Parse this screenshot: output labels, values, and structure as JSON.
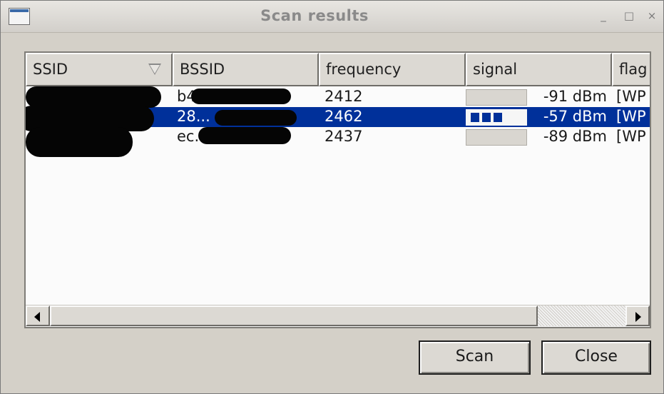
{
  "window": {
    "title": "Scan results",
    "minimize_label": "_",
    "maximize_label": "□",
    "close_label": "×"
  },
  "table": {
    "columns": [
      "SSID",
      "BSSID",
      "frequency",
      "signal",
      "flag"
    ],
    "sort_column": "SSID",
    "rows": [
      {
        "ssid": "...",
        "bssid": "b4...",
        "frequency": "2412",
        "signal_text": "-91 dBm",
        "signal_level": 0,
        "flags": "[WP",
        "selected": false
      },
      {
        "ssid": "...",
        "bssid": "28...",
        "frequency": "2462",
        "signal_text": "-57 dBm",
        "signal_level": 3,
        "flags": "[WP",
        "selected": true
      },
      {
        "ssid": "",
        "bssid": "ec...",
        "frequency": "2437",
        "signal_text": "-89 dBm",
        "signal_level": 0,
        "flags": "[WP",
        "selected": false
      }
    ]
  },
  "buttons": {
    "scan": "Scan",
    "close": "Close"
  },
  "colors": {
    "selection": "#00309a",
    "background": "#d4d0c8"
  }
}
